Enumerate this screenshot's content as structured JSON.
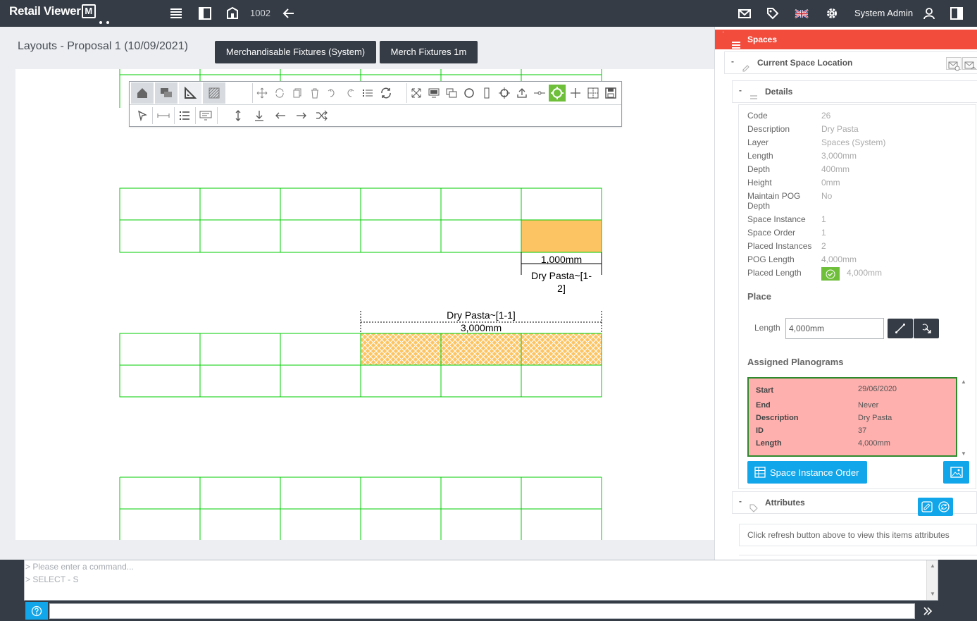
{
  "app": {
    "name": "Retail Viewer",
    "logo_mark": "M",
    "store_number": "1002",
    "user_name": "System Admin"
  },
  "page": {
    "title": "Layouts - Proposal 1 (10/09/2021)",
    "buttons": [
      "Merchandisable Fixtures (System)",
      "Merch Fixtures 1m"
    ]
  },
  "canvas": {
    "label_top": "1,000mm",
    "label_top_name_1": "Dry Pasta~[1-",
    "label_top_name_2": "2]",
    "label_mid_name": "Dry Pasta~[1-1]",
    "label_mid_length": "3,000mm"
  },
  "panel": {
    "title": "Spaces",
    "current_space": "Current Space Location",
    "details_title": "Details",
    "details": [
      {
        "label": "Code",
        "value": "26"
      },
      {
        "label": "Description",
        "value": "Dry Pasta"
      },
      {
        "label": "Layer",
        "value": "Spaces (System)"
      },
      {
        "label": "Length",
        "value": "3,000mm"
      },
      {
        "label": "Depth",
        "value": "400mm"
      },
      {
        "label": "Height",
        "value": "0mm"
      },
      {
        "label": "Maintain POG Depth",
        "value": "No"
      },
      {
        "label": "Space Instance",
        "value": "1"
      },
      {
        "label": "Space Order",
        "value": "1"
      },
      {
        "label": "Placed Instances",
        "value": "2"
      },
      {
        "label": "POG Length",
        "value": "4,000mm"
      },
      {
        "label": "Placed Length",
        "value": "4,000mm"
      }
    ],
    "place_title": "Place",
    "place_length_label": "Length",
    "place_length_value": "4,000mm",
    "assigned_title": "Assigned Planograms",
    "assigned": [
      {
        "label": "Start",
        "value": "29/06/2020"
      },
      {
        "label": "End",
        "value": "Never"
      },
      {
        "label": "Description",
        "value": "Dry Pasta"
      },
      {
        "label": "ID",
        "value": "37"
      },
      {
        "label": "Length",
        "value": "4,000mm"
      }
    ],
    "space_instance_order_btn": "Space Instance Order",
    "attributes_title": "Attributes",
    "attributes_note": "Click refresh button above to view this items attributes"
  },
  "command": {
    "placeholder_line": "> Please enter a command...",
    "last_line": "> SELECT - S"
  },
  "colors": {
    "topbar": "#353c45",
    "panel_header": "#f24c3d",
    "accent_blue": "#11a6ea",
    "grid_green": "#00cc00",
    "selected_fill": "#fcc463",
    "planogram_fill": "#fdb0ae"
  }
}
